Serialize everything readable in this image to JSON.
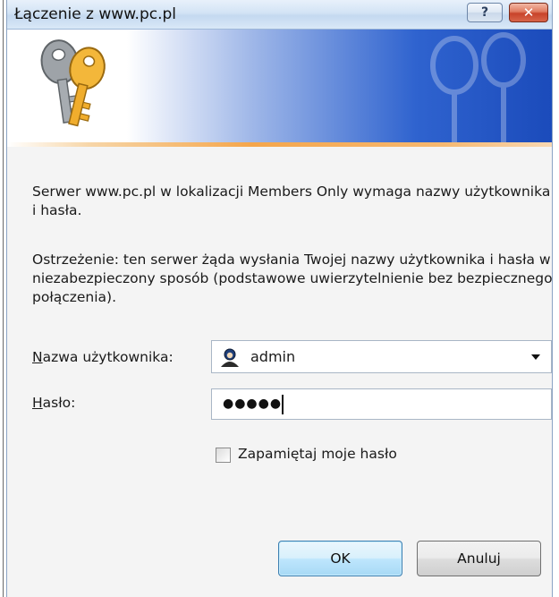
{
  "window": {
    "title": "Łączenie z www.pc.pl",
    "help_label": "?",
    "close_label": "✕"
  },
  "icons": {
    "banner": "keys-icon",
    "user": "user-account-icon",
    "dropdown": "chevron-down-icon"
  },
  "message": {
    "line1": "Serwer www.pc.pl w lokalizacji Members Only wymaga nazwy użytkownika i hasła.",
    "line2": "Ostrzeżenie: ten serwer żąda wysłania Twojej nazwy użytkownika i hasła w niezabezpieczony sposób (podstawowe uwierzytelnienie bez bezpiecznego połączenia)."
  },
  "form": {
    "username_label_mnemonic": "N",
    "username_label_rest": "azwa użytkownika:",
    "username_value": "admin",
    "password_label_mnemonic": "H",
    "password_label_rest": "asło:",
    "password_masked": "●●●●●",
    "remember_label": "Zapamiętaj moje hasło",
    "remember_checked": false
  },
  "buttons": {
    "ok": "OK",
    "cancel": "Anuluj"
  },
  "colors": {
    "banner_blue": "#2f63cf",
    "banner_orange": "#f5a64b",
    "close_red": "#c8432a",
    "ok_border": "#3c7fb1"
  }
}
